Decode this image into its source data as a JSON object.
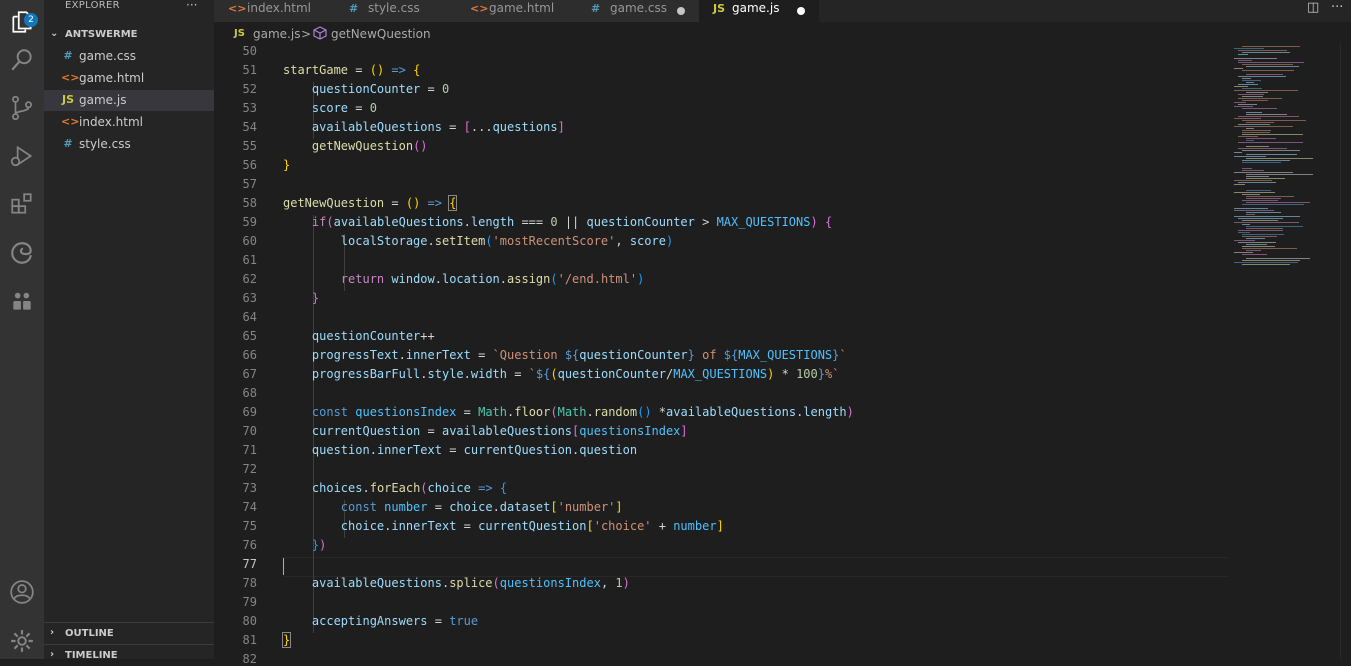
{
  "activity_bar": {
    "items": [
      {
        "name": "explorer",
        "icon": "files-icon"
      },
      {
        "name": "search",
        "icon": "search-icon"
      },
      {
        "name": "source-control",
        "icon": "source-control-icon"
      },
      {
        "name": "run-debug",
        "icon": "run-debug-icon"
      },
      {
        "name": "extensions",
        "icon": "extensions-icon"
      },
      {
        "name": "edge-devtools",
        "icon": "edge-icon"
      },
      {
        "name": "live-share",
        "icon": "live-share-icon"
      },
      {
        "name": "accounts",
        "icon": "account-icon"
      },
      {
        "name": "manage",
        "icon": "gear-icon"
      }
    ],
    "explorer_badge": "2"
  },
  "sidebar": {
    "title": "EXPLORER",
    "more": "···",
    "folder": "ANTSWERME",
    "files": [
      {
        "name": "game.css",
        "icon": "#",
        "icon_color": "#519aba"
      },
      {
        "name": "game.html",
        "icon": "<>",
        "icon_color": "#e37933"
      },
      {
        "name": "game.js",
        "icon": "JS",
        "icon_color": "#cbcb41",
        "active": true
      },
      {
        "name": "index.html",
        "icon": "<>",
        "icon_color": "#e37933"
      },
      {
        "name": "style.css",
        "icon": "#",
        "icon_color": "#519aba"
      }
    ],
    "panels": [
      "OUTLINE",
      "TIMELINE"
    ]
  },
  "tabs": [
    {
      "label": "index.html",
      "icon": "<>",
      "icon_color": "#e37933",
      "dirty": false,
      "active": false
    },
    {
      "label": "style.css",
      "icon": "#",
      "icon_color": "#519aba",
      "dirty": false,
      "active": false
    },
    {
      "label": "game.html",
      "icon": "<>",
      "icon_color": "#e37933",
      "dirty": false,
      "active": false
    },
    {
      "label": "game.css",
      "icon": "#",
      "icon_color": "#519aba",
      "dirty": true,
      "active": false
    },
    {
      "label": "game.js",
      "icon": "JS",
      "icon_color": "#cbcb41",
      "dirty": true,
      "active": true
    }
  ],
  "breadcrumb": {
    "file_icon": "JS",
    "file": "game.js",
    "separator": ">",
    "symbol": "getNewQuestion"
  },
  "editor": {
    "current_line": "77",
    "line_numbers": [
      "50",
      "51",
      "52",
      "53",
      "54",
      "55",
      "56",
      "57",
      "58",
      "59",
      "60",
      "61",
      "62",
      "63",
      "64",
      "65",
      "66",
      "67",
      "68",
      "69",
      "70",
      "71",
      "72",
      "73",
      "74",
      "75",
      "76",
      "77",
      "78",
      "79",
      "80",
      "81",
      "82"
    ]
  }
}
